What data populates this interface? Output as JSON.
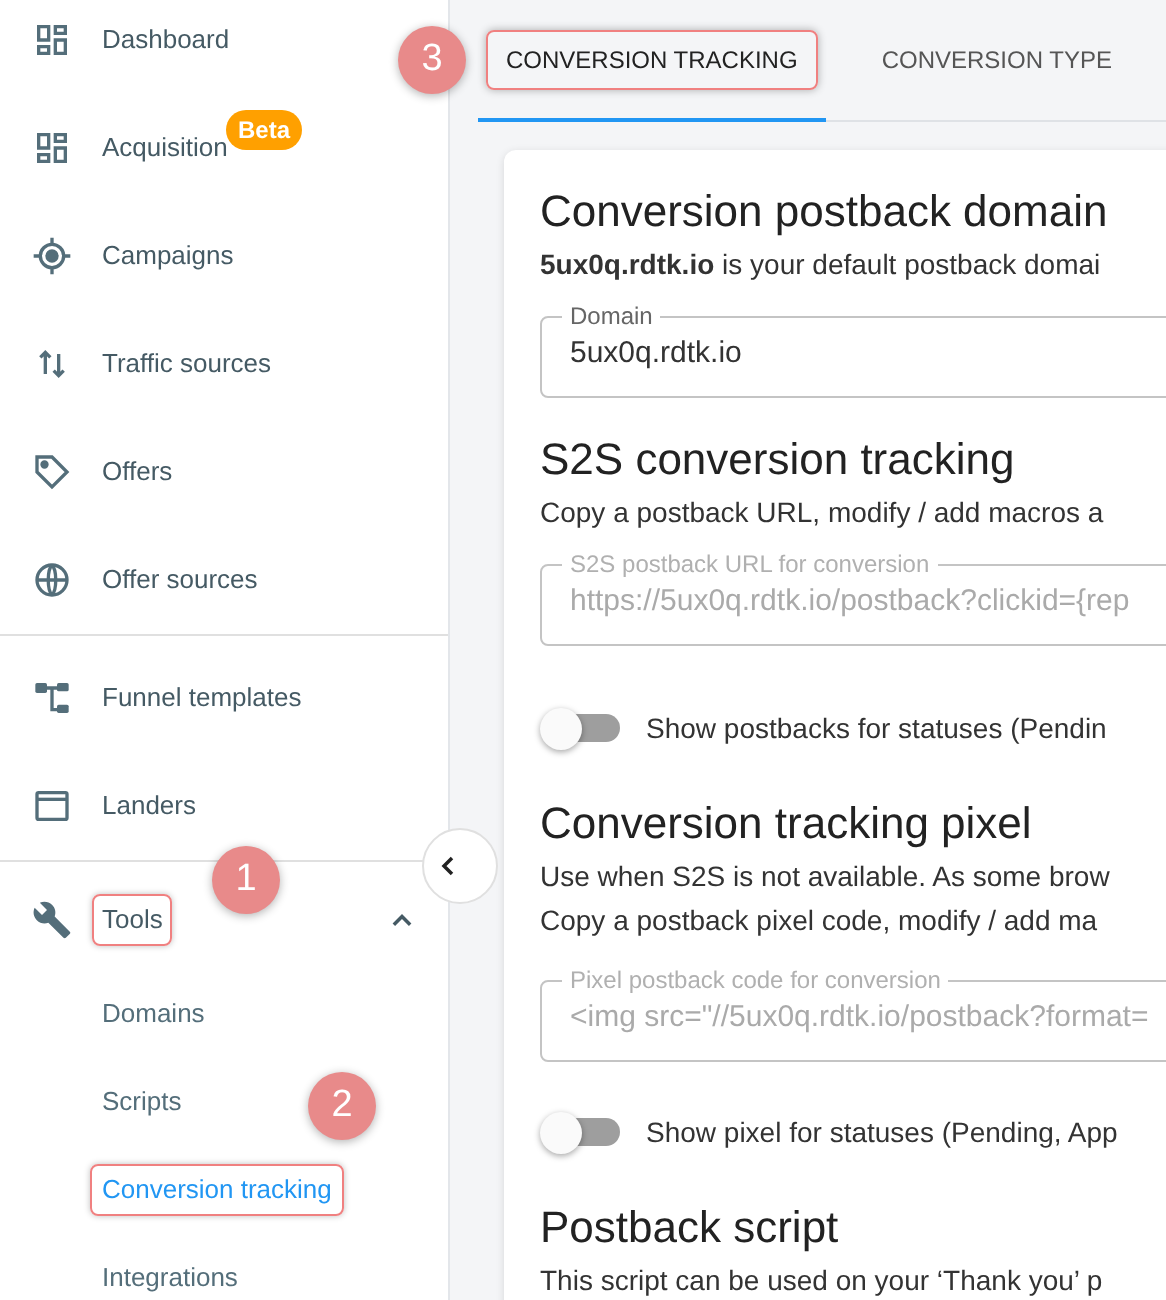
{
  "sidebar": {
    "groups": [
      {
        "items": [
          {
            "label": "Dashboard"
          },
          {
            "label": "Acquisition",
            "badge": "Beta"
          },
          {
            "label": "Campaigns"
          },
          {
            "label": "Traffic sources"
          },
          {
            "label": "Offers"
          },
          {
            "label": "Offer sources"
          }
        ]
      },
      {
        "items": [
          {
            "label": "Funnel templates"
          },
          {
            "label": "Landers"
          }
        ]
      },
      {
        "items": [
          {
            "label": "Tools",
            "highlighted": true,
            "expanded": true,
            "children": [
              {
                "label": "Domains",
                "selected": false,
                "highlighted": false
              },
              {
                "label": "Scripts",
                "selected": false,
                "highlighted": false
              },
              {
                "label": "Conversion tracking",
                "selected": true,
                "highlighted": true
              },
              {
                "label": "Integrations",
                "selected": false,
                "highlighted": false
              }
            ]
          }
        ]
      }
    ]
  },
  "tabs": [
    {
      "label": "CONVERSION TRACKING",
      "selected": true,
      "highlighted": true
    },
    {
      "label": "CONVERSION TYPE",
      "selected": false,
      "highlighted": false
    }
  ],
  "callouts": [
    {
      "number": "3"
    },
    {
      "number": "1"
    },
    {
      "number": "2"
    }
  ],
  "card": {
    "blocks": [
      {
        "kind": "heading",
        "text": "Conversion postback domain"
      },
      {
        "kind": "paragraph",
        "text": "**5ux0q.rdtk.io** is your default postback domai"
      },
      {
        "kind": "field",
        "label": "Domain",
        "value": "5ux0q.rdtk.io",
        "disabled": false
      },
      {
        "kind": "heading",
        "text": "S2S conversion tracking"
      },
      {
        "kind": "paragraph",
        "text": "Copy a postback URL, modify / add macros a"
      },
      {
        "kind": "field",
        "label": "S2S postback URL for conversion",
        "value": "https://5ux0q.rdtk.io/postback?clickid={rep",
        "disabled": true
      },
      {
        "kind": "toggle",
        "label": "Show postbacks for statuses (Pendin",
        "on": false
      },
      {
        "kind": "heading",
        "text": "Conversion tracking pixel"
      },
      {
        "kind": "paragraph",
        "text": "Use when S2S is not available. As some brow"
      },
      {
        "kind": "paragraph",
        "text": "Copy a postback pixel code, modify / add ma"
      },
      {
        "kind": "field",
        "label": "Pixel postback code for conversion",
        "value": "<img src=\"//5ux0q.rdtk.io/postback?format=",
        "disabled": true
      },
      {
        "kind": "toggle",
        "label": "Show pixel for statuses (Pending, App",
        "on": false
      },
      {
        "kind": "heading",
        "text": "Postback script"
      },
      {
        "kind": "paragraph",
        "text": "This script can be used on your ‘Thank you’ p"
      }
    ]
  }
}
